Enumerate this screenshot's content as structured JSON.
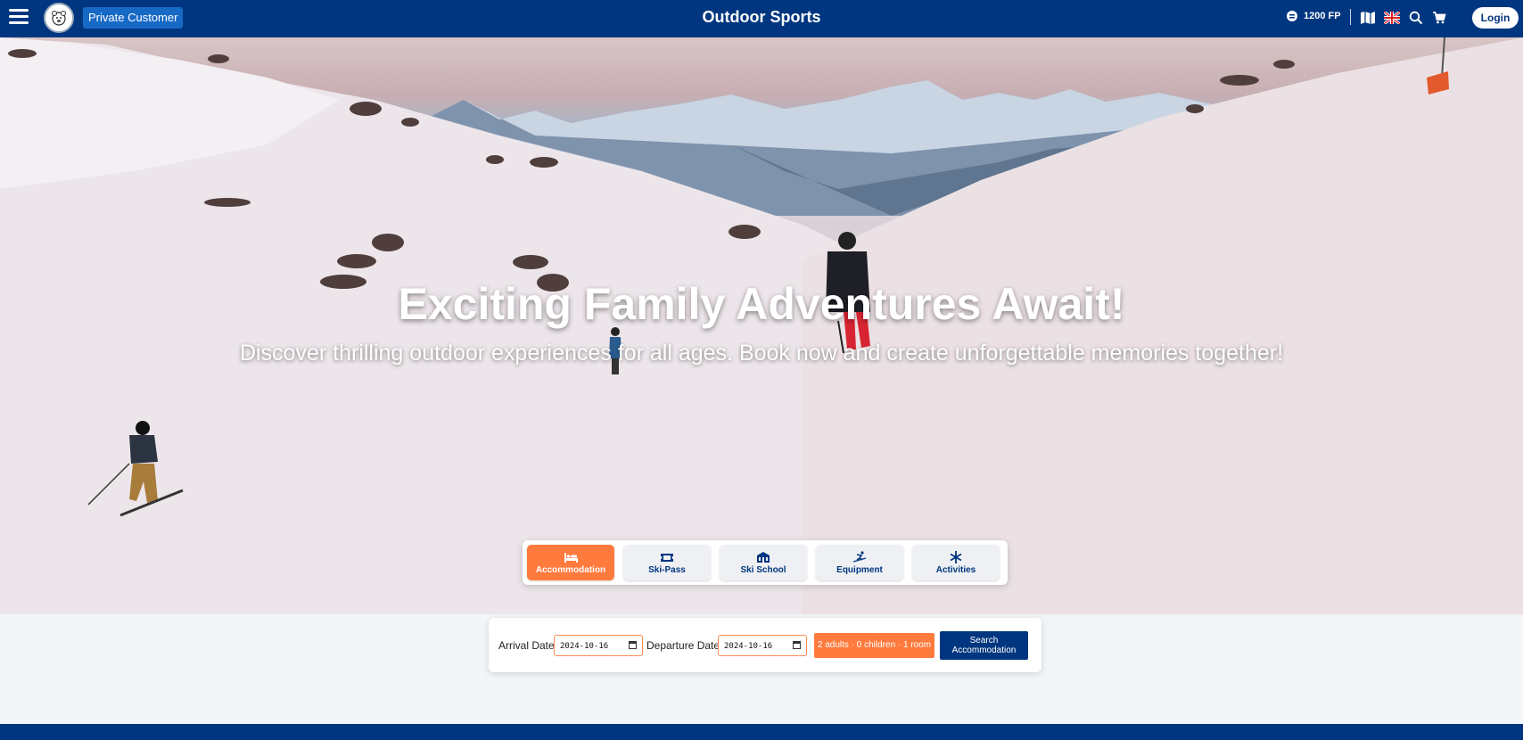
{
  "header": {
    "customer_type": "Private Customer",
    "title": "Outdoor Sports",
    "points": "1200 FP",
    "login_label": "Login",
    "icons": [
      "menu-icon",
      "logo",
      "coin-icon",
      "map-icon",
      "uk-flag-icon",
      "search-icon",
      "cart-icon"
    ]
  },
  "hero": {
    "title": "Exciting Family Adventures Await!",
    "subtitle": "Discover thrilling outdoor experiences for all ages. Book now and create unforgettable memories together!"
  },
  "tabs": [
    {
      "label": "Accommodation",
      "icon": "bed-icon",
      "active": true
    },
    {
      "label": "Ski-Pass",
      "icon": "ticket-icon",
      "active": false
    },
    {
      "label": "Ski School",
      "icon": "school-icon",
      "active": false
    },
    {
      "label": "Equipment",
      "icon": "skier-icon",
      "active": false
    },
    {
      "label": "Activities",
      "icon": "snowflake-icon",
      "active": false
    }
  ],
  "search": {
    "arrival_label": "Arrival Date:",
    "arrival_value": "2024-10-16",
    "departure_label": "Departure Date:",
    "departure_value": "2024-10-16",
    "guests_label": "2 adults · 0 children · 1 room",
    "search_line1": "Search",
    "search_line2": "Accommodation"
  },
  "colors": {
    "primary": "#003680",
    "accent": "#ff7a3d",
    "badge": "#1769c6"
  }
}
